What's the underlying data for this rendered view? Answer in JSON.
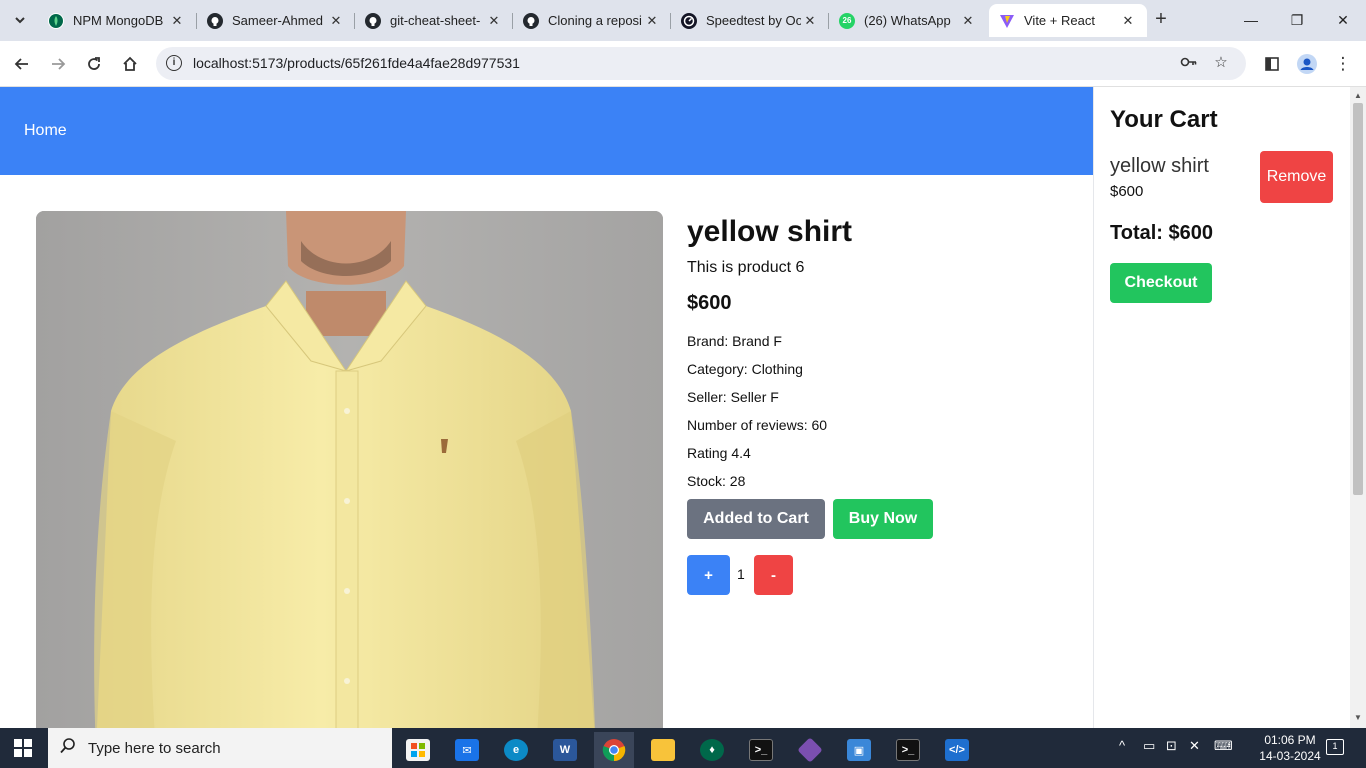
{
  "browser": {
    "tabs": [
      {
        "title": "NPM MongoDB",
        "favicon": "mongodb-leaf-icon",
        "color": "#00684a"
      },
      {
        "title": "Sameer-Ahmed",
        "favicon": "github-icon",
        "color": "#24292f"
      },
      {
        "title": "git-cheat-sheet-",
        "favicon": "github-icon",
        "color": "#24292f"
      },
      {
        "title": "Cloning a reposi",
        "favicon": "github-icon",
        "color": "#24292f"
      },
      {
        "title": "Speedtest by Oo",
        "favicon": "speedtest-icon",
        "color": "#141526"
      },
      {
        "title": "(26) WhatsApp",
        "favicon": "whatsapp-icon",
        "color": "#25d366",
        "badge": "26"
      },
      {
        "title": "Vite + React",
        "favicon": "vite-icon",
        "color": "#8b5cf6",
        "active": true
      }
    ],
    "url": "localhost:5173/products/65f261fde4a4fae28d977531"
  },
  "navbar": {
    "home_label": "Home",
    "background": "#3b82f6"
  },
  "product": {
    "title": "yellow shirt",
    "description": "This is product 6",
    "price": "$600",
    "brand": "Brand: Brand F",
    "category": "Category: Clothing",
    "seller": "Seller: Seller F",
    "reviews": "Number of reviews: 60",
    "rating": "Rating 4.4",
    "stock": "Stock: 28",
    "added_label": "Added to Cart",
    "buy_label": "Buy Now",
    "plus_label": "+",
    "minus_label": "-",
    "quantity": "1"
  },
  "cart": {
    "title": "Your Cart",
    "item_name": "yellow shirt",
    "item_price": "$600",
    "remove_label": "Remove",
    "total": "Total: $600",
    "checkout_label": "Checkout"
  },
  "taskbar": {
    "search_placeholder": "Type here to search",
    "time": "01:06 PM",
    "date": "14-03-2024",
    "notification_count": "1"
  },
  "colors": {
    "primary": "#3b82f6",
    "success": "#22c55e",
    "danger": "#ef4444",
    "muted": "#6b7280"
  }
}
